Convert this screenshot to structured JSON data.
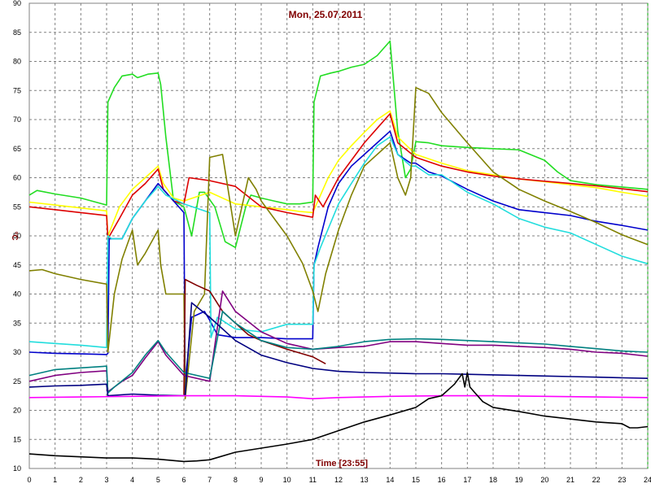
{
  "chart_data": {
    "type": "line",
    "title": "Mon, 25.07.2011",
    "xlabel": "Time [23:55]",
    "ylabel": "°C",
    "xlim": [
      0,
      24
    ],
    "ylim": [
      10,
      90
    ],
    "xticks": [
      "0",
      "1",
      "2",
      "3",
      "4",
      "5",
      "6",
      "7",
      "8",
      "9",
      "10",
      "11",
      "12",
      "13",
      "14",
      "15",
      "16",
      "17",
      "18",
      "19",
      "20",
      "21",
      "22",
      "23",
      "24"
    ],
    "yticks": [
      "10",
      "15",
      "20",
      "25",
      "30",
      "35",
      "40",
      "45",
      "50",
      "55",
      "60",
      "65",
      "70",
      "75",
      "80",
      "85",
      "90"
    ],
    "grid": true,
    "series": [
      {
        "color": "#22dd22",
        "x": [
          0,
          0.3,
          1,
          2,
          3,
          3.05,
          3.3,
          3.6,
          4,
          4.2,
          4.6,
          5,
          5.1,
          5.3,
          5.6,
          6,
          6.3,
          6.6,
          6.8,
          7.2,
          7.6,
          8,
          8.4,
          8.6,
          9,
          9.5,
          10,
          10.5,
          11,
          11.05,
          11.3,
          11.7,
          12,
          12.5,
          13,
          13.5,
          14,
          14.3,
          14.6,
          14.8,
          15,
          15.5,
          16,
          17,
          18,
          19,
          20,
          20.5,
          21,
          22,
          23,
          24
        ],
        "y": [
          57,
          57.8,
          57.2,
          56.5,
          55.3,
          73,
          75.5,
          77.5,
          77.8,
          77.2,
          77.8,
          78,
          76,
          67,
          56,
          55,
          50,
          57.5,
          57.5,
          55,
          49,
          48,
          55,
          57,
          56.5,
          56,
          55.5,
          55.5,
          55.8,
          73,
          77.5,
          78,
          78.3,
          79,
          79.5,
          81,
          83.5,
          68,
          60,
          61.5,
          66.2,
          66,
          65.5,
          65.2,
          65,
          64.8,
          63,
          61,
          59.5,
          58.8,
          58.4,
          58
        ]
      },
      {
        "color": "#ffff00",
        "x": [
          0,
          1,
          2,
          3,
          3.05,
          3.5,
          4,
          4.5,
          5,
          5.2,
          5.6,
          6,
          7,
          8,
          9,
          10,
          10.5,
          11,
          11.2,
          11.6,
          12,
          12.5,
          13,
          13.5,
          14,
          14.3,
          15,
          16,
          17,
          18,
          19,
          20,
          21,
          22,
          23,
          24
        ],
        "y": [
          55.8,
          55.3,
          54.8,
          54.3,
          50,
          55,
          58,
          60,
          62,
          59,
          56.5,
          56,
          57.5,
          55.5,
          55,
          54.5,
          54.2,
          54,
          56,
          60,
          63,
          65.5,
          67.8,
          70,
          71.5,
          67,
          64,
          62.5,
          61.2,
          60.5,
          59.8,
          59.3,
          58.8,
          58.3,
          57.5,
          56.8
        ]
      },
      {
        "color": "#dd0000",
        "x": [
          0,
          1,
          2,
          3,
          3.05,
          3.5,
          4,
          4.5,
          5,
          5.2,
          5.6,
          6,
          6.2,
          7,
          8,
          9,
          10,
          11,
          11.1,
          11.4,
          12,
          12.5,
          13,
          13.5,
          14,
          14.3,
          15,
          16,
          17,
          18,
          19,
          20,
          21,
          22,
          23,
          24
        ],
        "y": [
          55,
          54.5,
          54,
          53.5,
          49.5,
          53,
          57,
          59,
          61.5,
          58,
          56,
          55.5,
          60,
          59.5,
          58.5,
          55,
          54,
          53.2,
          57,
          55,
          60,
          63,
          66,
          68.5,
          71,
          66,
          63.5,
          62,
          61,
          60.3,
          59.8,
          59.4,
          59,
          58.6,
          58.1,
          57.6
        ]
      },
      {
        "color": "#0000cc",
        "x": [
          0,
          1,
          2,
          3,
          3.05,
          3.1,
          3.6,
          4,
          4.5,
          5,
          5.3,
          6,
          6.05,
          6.1,
          6.3,
          6.8,
          7,
          7.3,
          8,
          9,
          10,
          11,
          11.05,
          11.2,
          11.6,
          12,
          12.5,
          13,
          13.5,
          14,
          14.3,
          14.8,
          15,
          15.5,
          16,
          17,
          18,
          19,
          20,
          21,
          22,
          23,
          24
        ],
        "y": [
          30,
          29.8,
          29.7,
          29.6,
          29.8,
          49.5,
          49.5,
          53,
          56,
          59,
          57.5,
          54,
          23,
          27,
          36,
          37,
          35.5,
          33,
          32.5,
          32.5,
          32.3,
          32.3,
          45,
          48,
          55,
          59,
          62,
          64,
          66,
          68,
          64,
          62.5,
          62.5,
          61,
          60.3,
          58,
          56,
          54.5,
          54,
          53.5,
          52.5,
          51.8,
          51
        ]
      },
      {
        "color": "#22dddd",
        "x": [
          0,
          1,
          2,
          3,
          3.05,
          3.2,
          3.6,
          4,
          4.5,
          5,
          5.3,
          6,
          7,
          7.05,
          7.3,
          8,
          9,
          10,
          11,
          11.05,
          11.3,
          12,
          12.5,
          13,
          13.5,
          14,
          14.3,
          14.8,
          15,
          15.5,
          16,
          16.5,
          17,
          18,
          19,
          20,
          21,
          22,
          23,
          24
        ],
        "y": [
          31.8,
          31.5,
          31.2,
          30.8,
          50,
          49.5,
          49.5,
          53,
          56,
          58.5,
          57,
          55.5,
          54,
          32.5,
          36,
          34,
          33.5,
          34.8,
          34.8,
          45,
          48,
          55.5,
          59,
          62.5,
          65.5,
          67,
          64,
          62,
          62,
          60.5,
          60.5,
          59,
          57.5,
          55.5,
          53,
          51.5,
          50.5,
          48.5,
          46.5,
          45.2
        ]
      },
      {
        "color": "#808000",
        "x": [
          0,
          0.5,
          1,
          2,
          3,
          3.05,
          3.3,
          3.6,
          4,
          4.2,
          4.5,
          5,
          5.1,
          5.3,
          6,
          6.05,
          6.4,
          6.8,
          7,
          7.5,
          8,
          8.5,
          8.8,
          9,
          10,
          10.6,
          11,
          11.2,
          11.5,
          12,
          12.5,
          13,
          14,
          14.3,
          14.6,
          14.8,
          15,
          15.5,
          16,
          17,
          18,
          19,
          20,
          21,
          22,
          23,
          24
        ],
        "y": [
          44,
          44.2,
          43.5,
          42.5,
          41.7,
          30,
          40,
          46,
          51,
          45,
          47,
          51,
          45,
          40,
          40,
          22,
          37,
          40,
          63.5,
          64,
          50,
          60,
          58,
          56,
          50,
          45.3,
          40.5,
          37,
          43.5,
          51,
          57,
          62,
          66,
          60,
          57,
          60,
          75.5,
          74.5,
          71.2,
          66,
          61,
          58,
          56,
          54.2,
          52.3,
          50.2,
          48.5
        ]
      },
      {
        "color": "#800000",
        "x": [
          6,
          6.05,
          6.5,
          7,
          7.5,
          8,
          8.5,
          9,
          10,
          11,
          11.5
        ],
        "y": [
          22.7,
          42.5,
          41.5,
          40.5,
          37,
          35,
          33,
          32,
          30.5,
          29.2,
          28
        ]
      },
      {
        "color": "#800080",
        "x": [
          0,
          1,
          2,
          3,
          3.05,
          3.3,
          3.6,
          4,
          4.5,
          5,
          5.3,
          6,
          7,
          7.5,
          8,
          9,
          10,
          11,
          12,
          13,
          14,
          15,
          16,
          17,
          18,
          19,
          20,
          21,
          22,
          23,
          24
        ],
        "y": [
          25,
          26,
          26.5,
          26.8,
          23.2,
          24,
          25,
          26,
          29,
          31.8,
          29.5,
          26,
          25,
          40.5,
          37,
          33.5,
          31.5,
          30.5,
          30.8,
          31,
          31.8,
          31.8,
          31.5,
          31.2,
          31.2,
          31,
          30.8,
          30.5,
          30,
          29.8,
          29.3
        ]
      },
      {
        "color": "#008080",
        "x": [
          0,
          1,
          2,
          3,
          3.05,
          3.3,
          4,
          4.5,
          5,
          5.3,
          6,
          7,
          7.5,
          8,
          9,
          10,
          11,
          12,
          13,
          14,
          15,
          16,
          17,
          18,
          19,
          20,
          21,
          22,
          23,
          24
        ],
        "y": [
          26,
          27,
          27.3,
          27.6,
          23,
          24,
          26.5,
          29.5,
          32,
          30,
          26.5,
          25.5,
          37,
          35,
          32,
          30.8,
          30.5,
          31,
          31.8,
          32.2,
          32.3,
          32.2,
          32,
          31.8,
          31.6,
          31.4,
          31,
          30.6,
          30.2,
          30
        ]
      },
      {
        "color": "#000080",
        "x": [
          0,
          1,
          2,
          3,
          3.05,
          4,
          5,
          6,
          6.05,
          6.3,
          7,
          8,
          9,
          10,
          11,
          12,
          13,
          14,
          15,
          16,
          17,
          18,
          19,
          20,
          21,
          22,
          23,
          24
        ],
        "y": [
          24,
          24.2,
          24.3,
          24.5,
          22.5,
          22.8,
          22.6,
          22.5,
          22.7,
          38.5,
          36,
          32,
          29.5,
          28.2,
          27.2,
          26.7,
          26.5,
          26.4,
          26.3,
          26.3,
          26.2,
          26.1,
          26,
          25.9,
          25.8,
          25.7,
          25.6,
          25.5
        ]
      },
      {
        "color": "#ff00ff",
        "x": [
          0,
          2,
          4,
          6,
          8,
          10,
          11,
          12,
          14,
          16,
          18,
          20,
          22,
          24
        ],
        "y": [
          22.2,
          22.3,
          22.4,
          22.5,
          22.5,
          22.3,
          22,
          22.2,
          22.4,
          22.5,
          22.5,
          22.4,
          22.3,
          22.2
        ]
      },
      {
        "color": "#000000",
        "x": [
          0,
          1,
          2,
          3,
          4,
          5,
          6,
          6.5,
          7,
          8,
          9,
          10,
          11,
          12,
          13,
          14,
          15,
          15.5,
          16,
          16.5,
          16.8,
          16.9,
          17,
          17.1,
          17.3,
          17.6,
          18,
          19,
          20,
          21,
          22,
          23,
          23.3,
          23.6,
          24
        ],
        "y": [
          12.5,
          12.2,
          12,
          11.8,
          11.8,
          11.6,
          11.2,
          11.3,
          11.5,
          12.8,
          13.5,
          14.2,
          15,
          16.5,
          18,
          19.2,
          20.5,
          22,
          22.5,
          24.5,
          26.3,
          24,
          26.5,
          24,
          23,
          21.5,
          20.5,
          19.8,
          19,
          18.5,
          18,
          17.7,
          17,
          17,
          17.2
        ]
      }
    ]
  }
}
